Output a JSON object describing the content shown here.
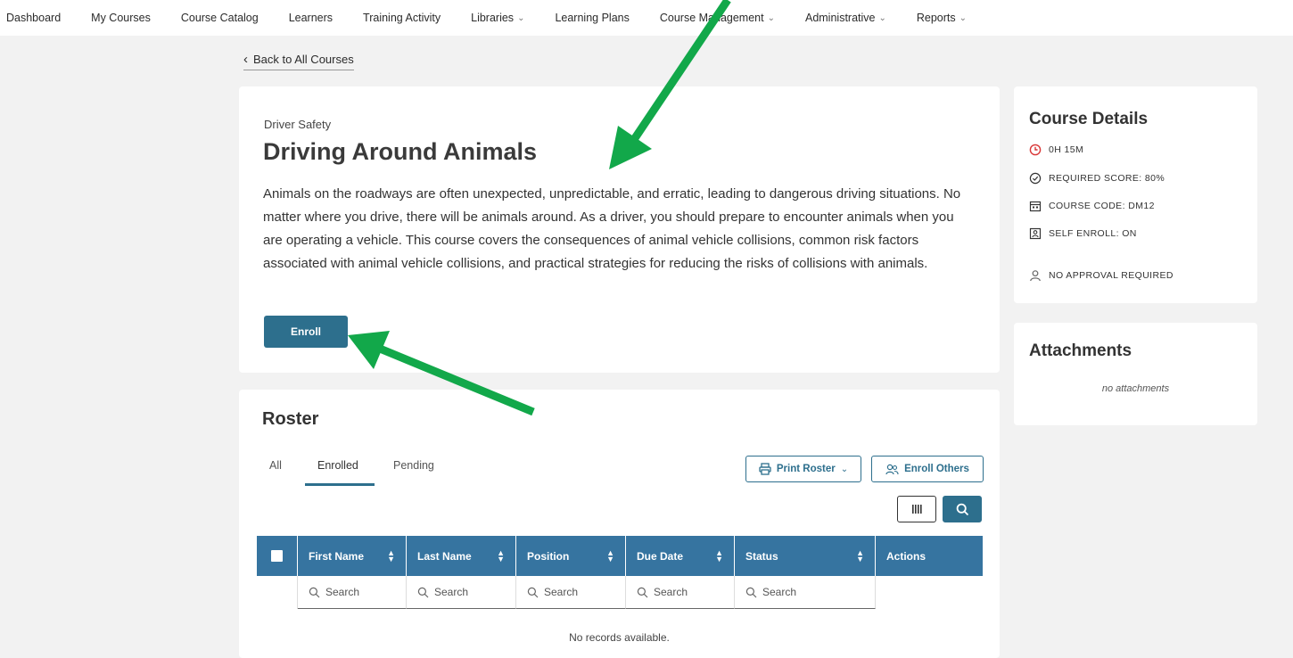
{
  "nav": {
    "items": [
      {
        "label": "Dashboard",
        "dropdown": false
      },
      {
        "label": "My Courses",
        "dropdown": false
      },
      {
        "label": "Course Catalog",
        "dropdown": false
      },
      {
        "label": "Learners",
        "dropdown": false
      },
      {
        "label": "Training Activity",
        "dropdown": false
      },
      {
        "label": "Libraries",
        "dropdown": true
      },
      {
        "label": "Learning Plans",
        "dropdown": false
      },
      {
        "label": "Course Management",
        "dropdown": true
      },
      {
        "label": "Administrative",
        "dropdown": true
      },
      {
        "label": "Reports",
        "dropdown": true
      }
    ]
  },
  "back_link": "Back to All Courses",
  "course": {
    "category": "Driver Safety",
    "title": "Driving Around Animals",
    "description": "Animals on the roadways are often unexpected, unpredictable, and erratic, leading to dangerous driving situations. No matter where you drive, there will be animals around. As a driver, you should prepare to encounter animals when you are operating a vehicle. This course covers the consequences of animal vehicle collisions, common risk factors associated with animal vehicle collisions, and practical strategies for reducing the risks of collisions with animals.",
    "enroll_label": "Enroll"
  },
  "roster": {
    "title": "Roster",
    "tabs": [
      "All",
      "Enrolled",
      "Pending"
    ],
    "active_tab": "Enrolled",
    "print_label": "Print Roster",
    "enroll_others_label": "Enroll Others",
    "columns": [
      "First Name",
      "Last Name",
      "Position",
      "Due Date",
      "Status",
      "Actions"
    ],
    "search_placeholder": "Search",
    "empty_text": "No records available."
  },
  "details": {
    "title": "Course Details",
    "duration": "0H 15M",
    "required_score": "REQUIRED SCORE: 80%",
    "course_code": "COURSE CODE: DM12",
    "self_enroll": "SELF ENROLL: ON",
    "approval": "NO APPROVAL REQUIRED"
  },
  "attachments": {
    "title": "Attachments",
    "empty_text": "no attachments"
  },
  "colors": {
    "primary": "#2d6f8d",
    "table_header": "#3674a0",
    "annotation_arrow": "#12a84a",
    "clock_icon": "#d93636"
  }
}
